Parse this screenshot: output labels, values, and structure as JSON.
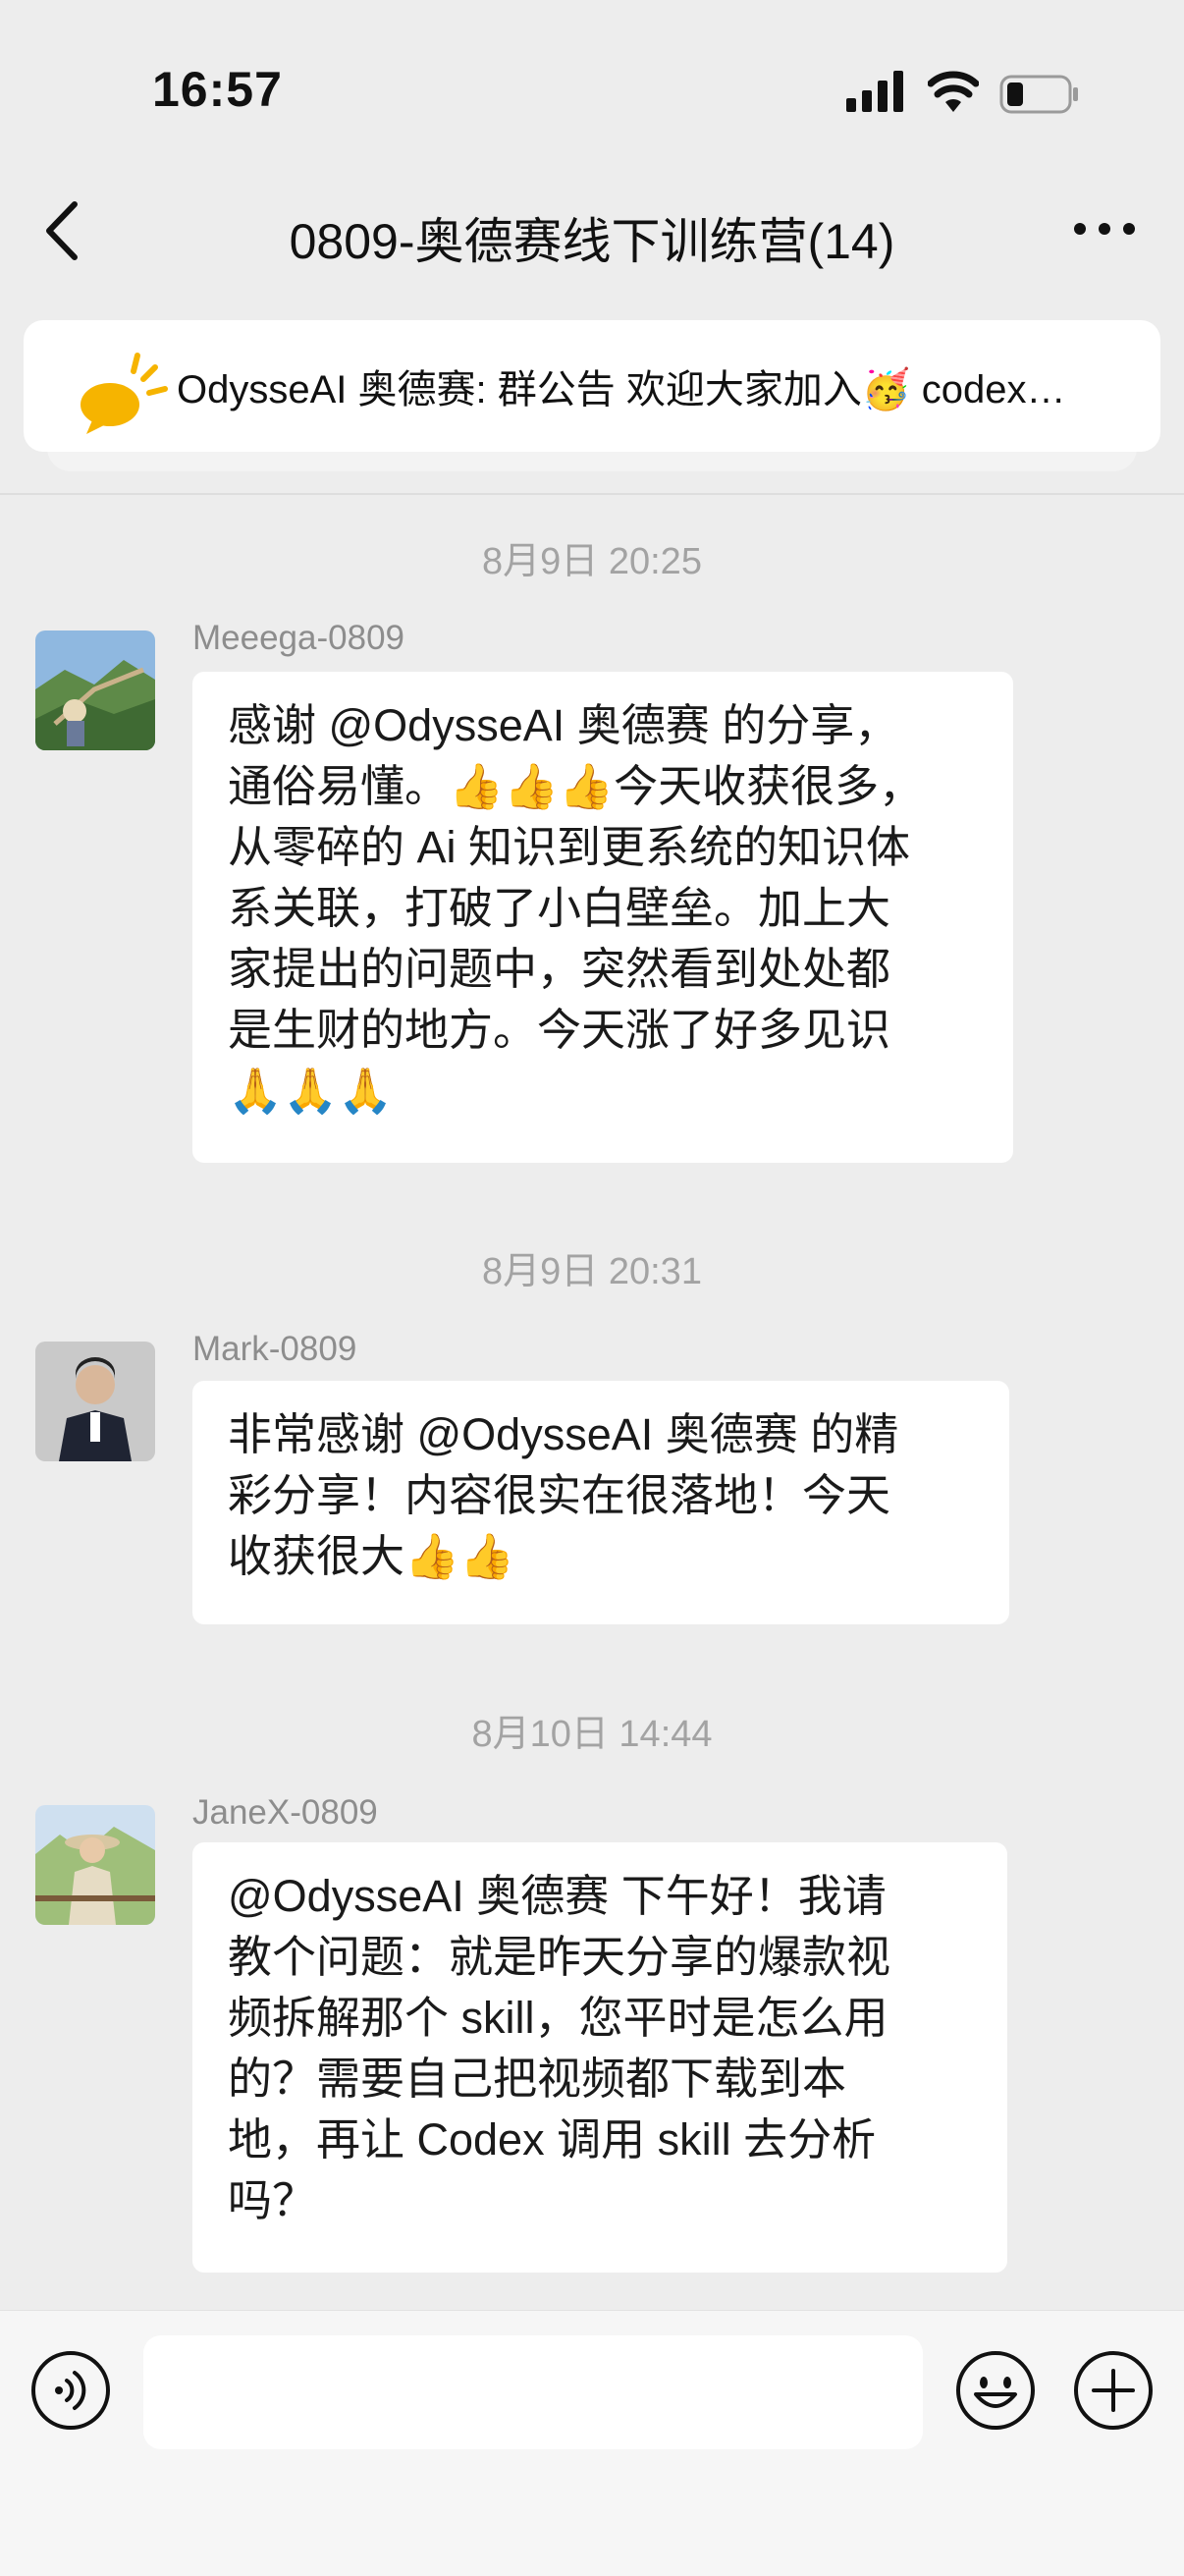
{
  "status": {
    "time": "16:57"
  },
  "header": {
    "title": "0809-奥德赛线下训练营(14)"
  },
  "announcement": {
    "text": "OdysseAI 奥德赛: 群公告 欢迎大家加入🥳 codex…"
  },
  "messages": [
    {
      "timestamp": "8月9日 20:25",
      "sender": "Meeega-0809",
      "lines": [
        "感谢 @OdysseAI 奥德赛 的分享，",
        "通俗易懂。👍👍👍今天收获很多，",
        "从零碎的 Ai 知识到更系统的知识体",
        "系关联，打破了小白壁垒。加上大",
        "家提出的问题中，突然看到处处都",
        "是生财的地方。今天涨了好多见识",
        "🙏🙏🙏"
      ]
    },
    {
      "timestamp": "8月9日 20:31",
      "sender": "Mark-0809",
      "lines": [
        "非常感谢 @OdysseAI 奥德赛  的精",
        "彩分享！内容很实在很落地！今天",
        "收获很大👍👍"
      ]
    },
    {
      "timestamp": "8月10日 14:44",
      "sender": "JaneX-0809",
      "lines": [
        "@OdysseAI 奥德赛 下午好！我请",
        "教个问题：就是昨天分享的爆款视",
        "频拆解那个 skill，您平时是怎么用",
        "的？需要自己把视频都下载到本",
        "地，再让 Codex 调用 skill 去分析",
        "吗？"
      ]
    }
  ],
  "input": {
    "placeholder": ""
  },
  "colors": {
    "background": "#ededed",
    "bubble": "#ffffff",
    "accent_icon": "#f6b400"
  },
  "icons": [
    "signal-icon",
    "wifi-icon",
    "battery-icon",
    "back-icon",
    "more-icon",
    "megaphone-icon",
    "voice-icon",
    "emoji-icon",
    "plus-icon"
  ]
}
